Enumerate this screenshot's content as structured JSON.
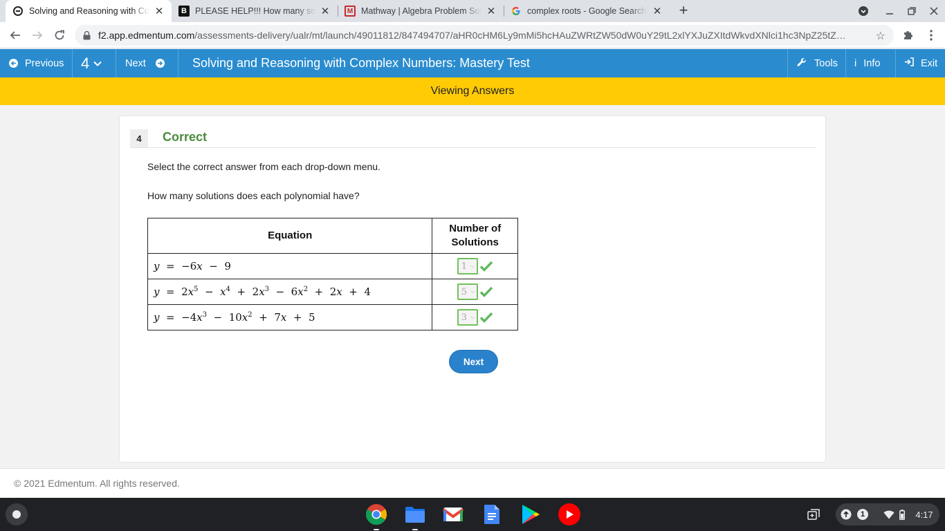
{
  "browser": {
    "tabs": [
      {
        "title": "Solving and Reasoning with Complex Numbers",
        "icon": "edmentum-icon",
        "active": true
      },
      {
        "title": "PLEASE HELP!!! How many solutions",
        "icon": "brainly-icon",
        "active": false
      },
      {
        "title": "Mathway | Algebra Problem Solver",
        "icon": "mathway-icon",
        "active": false
      },
      {
        "title": "complex roots - Google Search",
        "icon": "google-icon",
        "active": false
      }
    ],
    "url_host": "f2.app.edmentum.com",
    "url_path": "/assessments-delivery/ualr/mt/launch/49011812/847494707/aHR0cHM6Ly9mMi5hcHAuZWRtZW50dW0uY29tL2xlYXJuZXItdWkvdXNlci1hc3NpZ25tZ…"
  },
  "header": {
    "previous_label": "Previous",
    "question_number": "4",
    "next_label": "Next",
    "title": "Solving and Reasoning with Complex Numbers: Mastery Test",
    "tools_label": "Tools",
    "info_label": "Info",
    "exit_label": "Exit"
  },
  "banner": {
    "text": "Viewing Answers"
  },
  "question": {
    "number": "4",
    "status": "Correct",
    "instruction": "Select the correct answer from each drop-down menu.",
    "prompt": "How many solutions does each polynomial have?",
    "table": {
      "col_equation": "Equation",
      "col_solutions_line1": "Number of",
      "col_solutions_line2": "Solutions",
      "rows": [
        {
          "answer": "1",
          "correct": true
        },
        {
          "answer": "5",
          "correct": true
        },
        {
          "answer": "3",
          "correct": true
        }
      ]
    },
    "next_button": "Next"
  },
  "footer": {
    "copyright": "© 2021 Edmentum. All rights reserved."
  },
  "shelf": {
    "apps": [
      "chrome-icon",
      "files-icon",
      "gmail-icon",
      "docs-icon",
      "play-store-icon",
      "youtube-icon"
    ],
    "notification_count": "1",
    "time": "4:17"
  },
  "colors": {
    "header_blue": "#2a8ccf",
    "banner_yellow": "#ffcb05",
    "correct_green": "#4b8a3c",
    "check_green": "#5cb85c"
  }
}
